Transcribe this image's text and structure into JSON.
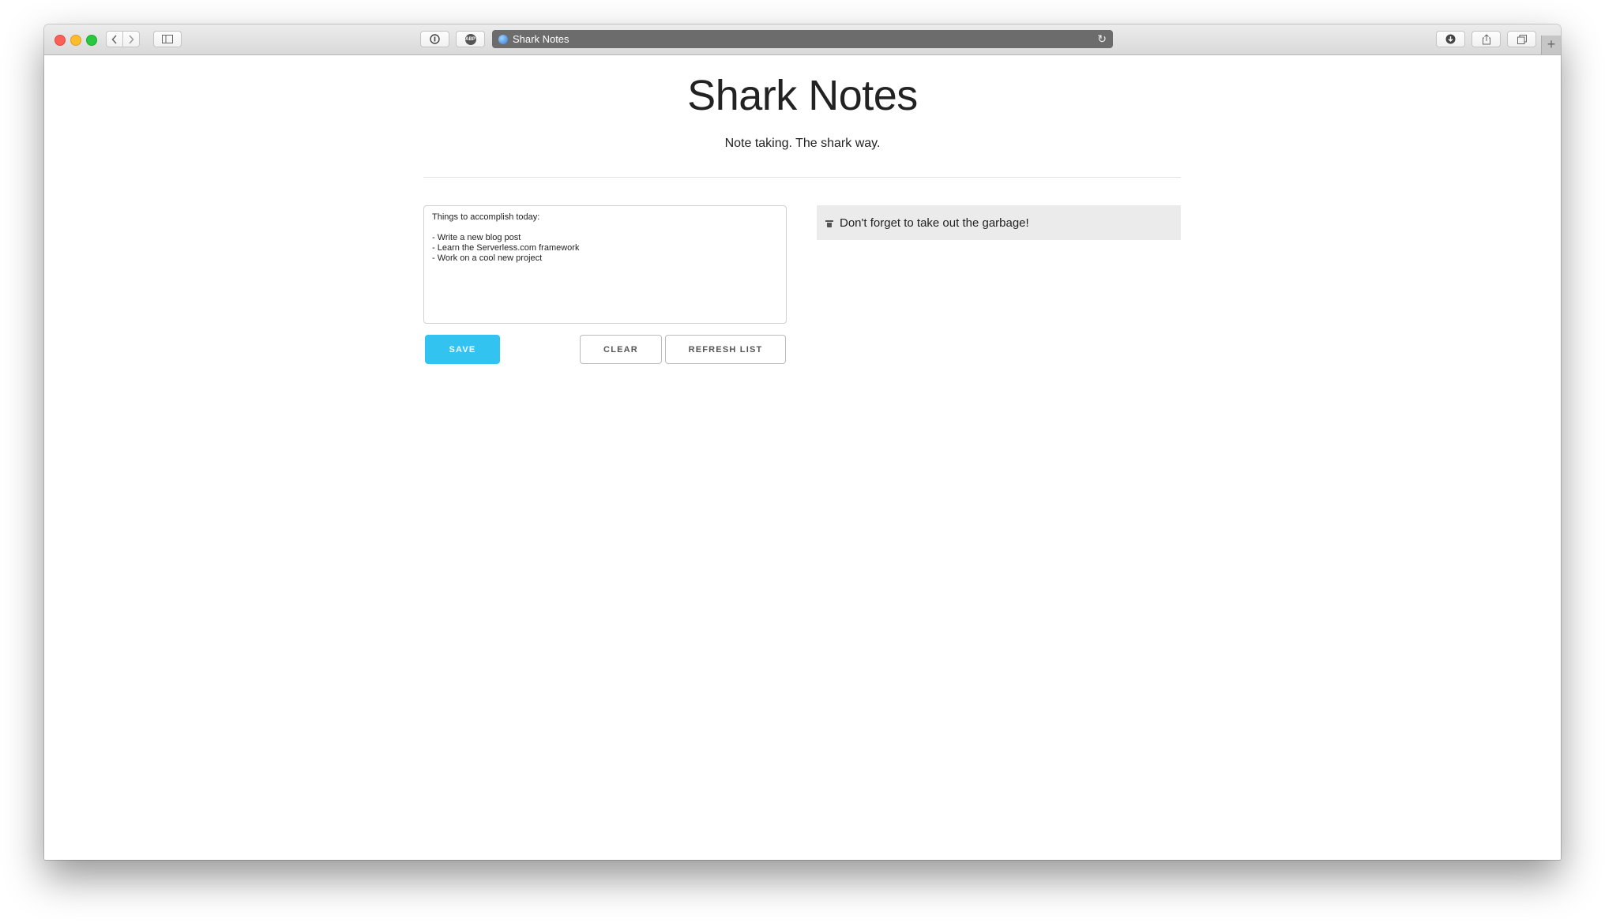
{
  "browser": {
    "tab_title": "Shark Notes",
    "icons": {
      "back": "chevron-left-icon",
      "forward": "chevron-right-icon",
      "sidebar": "sidebar-icon",
      "info": "info-icon",
      "adblock": "adblock-icon",
      "adblock_label": "ABP",
      "reload": "reload-icon",
      "download": "download-icon",
      "share": "share-icon",
      "tabs": "tabs-icon",
      "new_tab": "plus-icon"
    }
  },
  "page": {
    "title": "Shark Notes",
    "tagline": "Note taking. The shark way.",
    "editor": {
      "value": "Things to accomplish today:\n\n- Write a new blog post\n- Learn the Serverless.com framework\n- Work on a cool new project"
    },
    "buttons": {
      "save": "SAVE",
      "clear": "CLEAR",
      "refresh": "REFRESH LIST"
    },
    "notes": [
      {
        "text": "Don't forget to take out the garbage!",
        "icon": "trash-icon"
      }
    ]
  },
  "colors": {
    "accent": "#33c3f0",
    "note_bg": "#ebebeb"
  }
}
